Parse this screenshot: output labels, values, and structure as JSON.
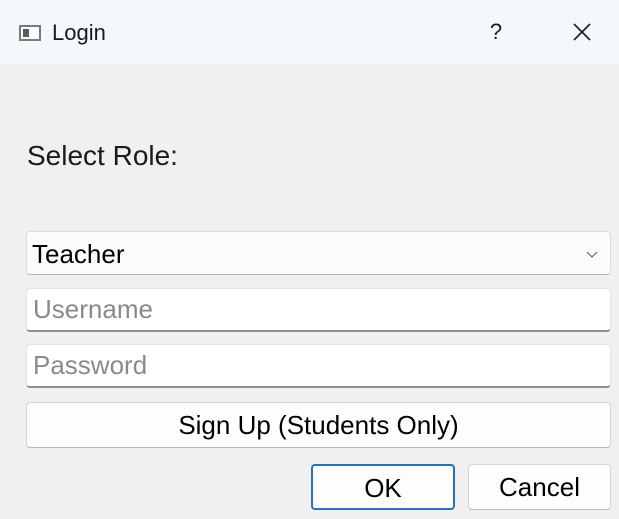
{
  "window": {
    "title": "Login",
    "icon": "app-window-icon",
    "help_label": "?",
    "close_icon": "close-icon"
  },
  "form": {
    "role_label": "Select Role:",
    "role_select": {
      "selected": "Teacher",
      "icon": "chevron-down-icon"
    },
    "username": {
      "value": "",
      "placeholder": "Username"
    },
    "password": {
      "value": "",
      "placeholder": "Password"
    },
    "signup_label": "Sign Up (Students Only)"
  },
  "buttons": {
    "ok_label": "OK",
    "cancel_label": "Cancel"
  },
  "colors": {
    "titlebar_bg": "#f3f8fb",
    "dialog_bg": "#f0f0f0",
    "default_button_border": "#2a72b8"
  }
}
